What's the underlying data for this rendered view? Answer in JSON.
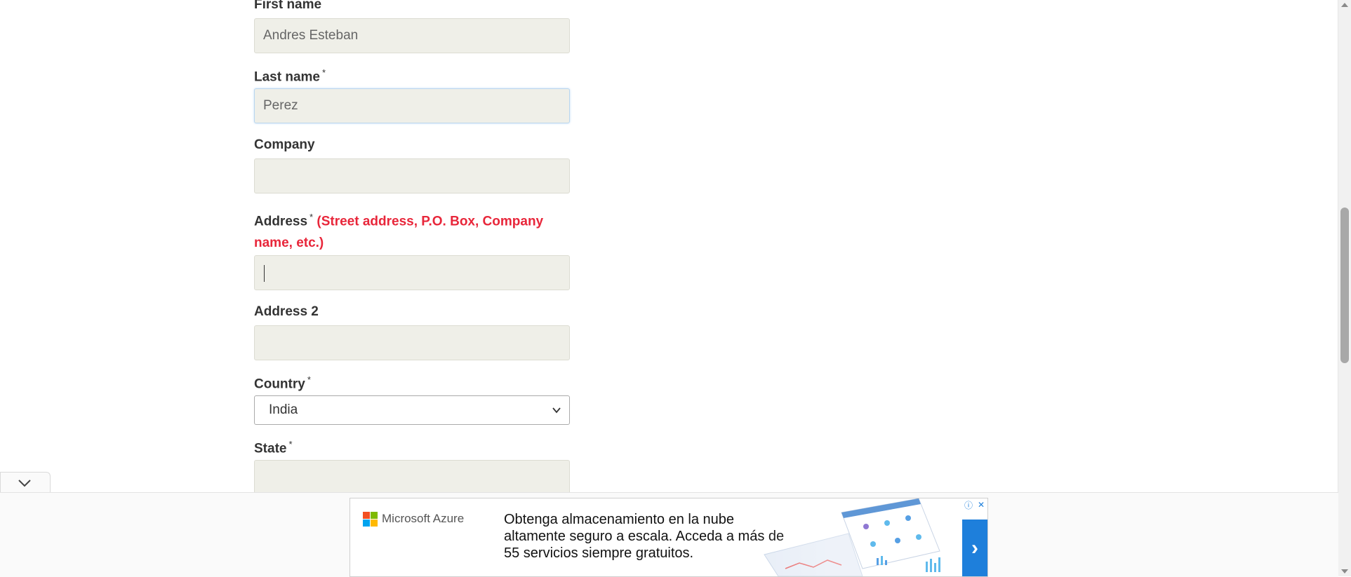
{
  "form": {
    "first_name": {
      "label": "First name",
      "value": "Andres Esteban"
    },
    "last_name": {
      "label": "Last name",
      "required_mark": "*",
      "value": "Perez"
    },
    "company": {
      "label": "Company",
      "value": ""
    },
    "address": {
      "label": "Address",
      "required_mark": "*",
      "hint": "(Street address, P.O. Box, Company name, etc.)",
      "value": ""
    },
    "address2": {
      "label": "Address 2",
      "value": ""
    },
    "country": {
      "label": "Country",
      "required_mark": "*",
      "selected": "India"
    },
    "state": {
      "label": "State",
      "required_mark": "*",
      "value": ""
    }
  },
  "ad": {
    "brand": "Microsoft Azure",
    "text": "Obtenga almacenamiento en la nube altamente seguro a escala. Acceda a más de 55 servicios siempre gratuitos.",
    "arrow": "›",
    "info_icon": "ⓘ",
    "close_icon": "✕"
  },
  "colors": {
    "hint": "#e8263a",
    "input_bg": "#efefe8",
    "ad_arrow_bg": "#1e7fdb"
  }
}
